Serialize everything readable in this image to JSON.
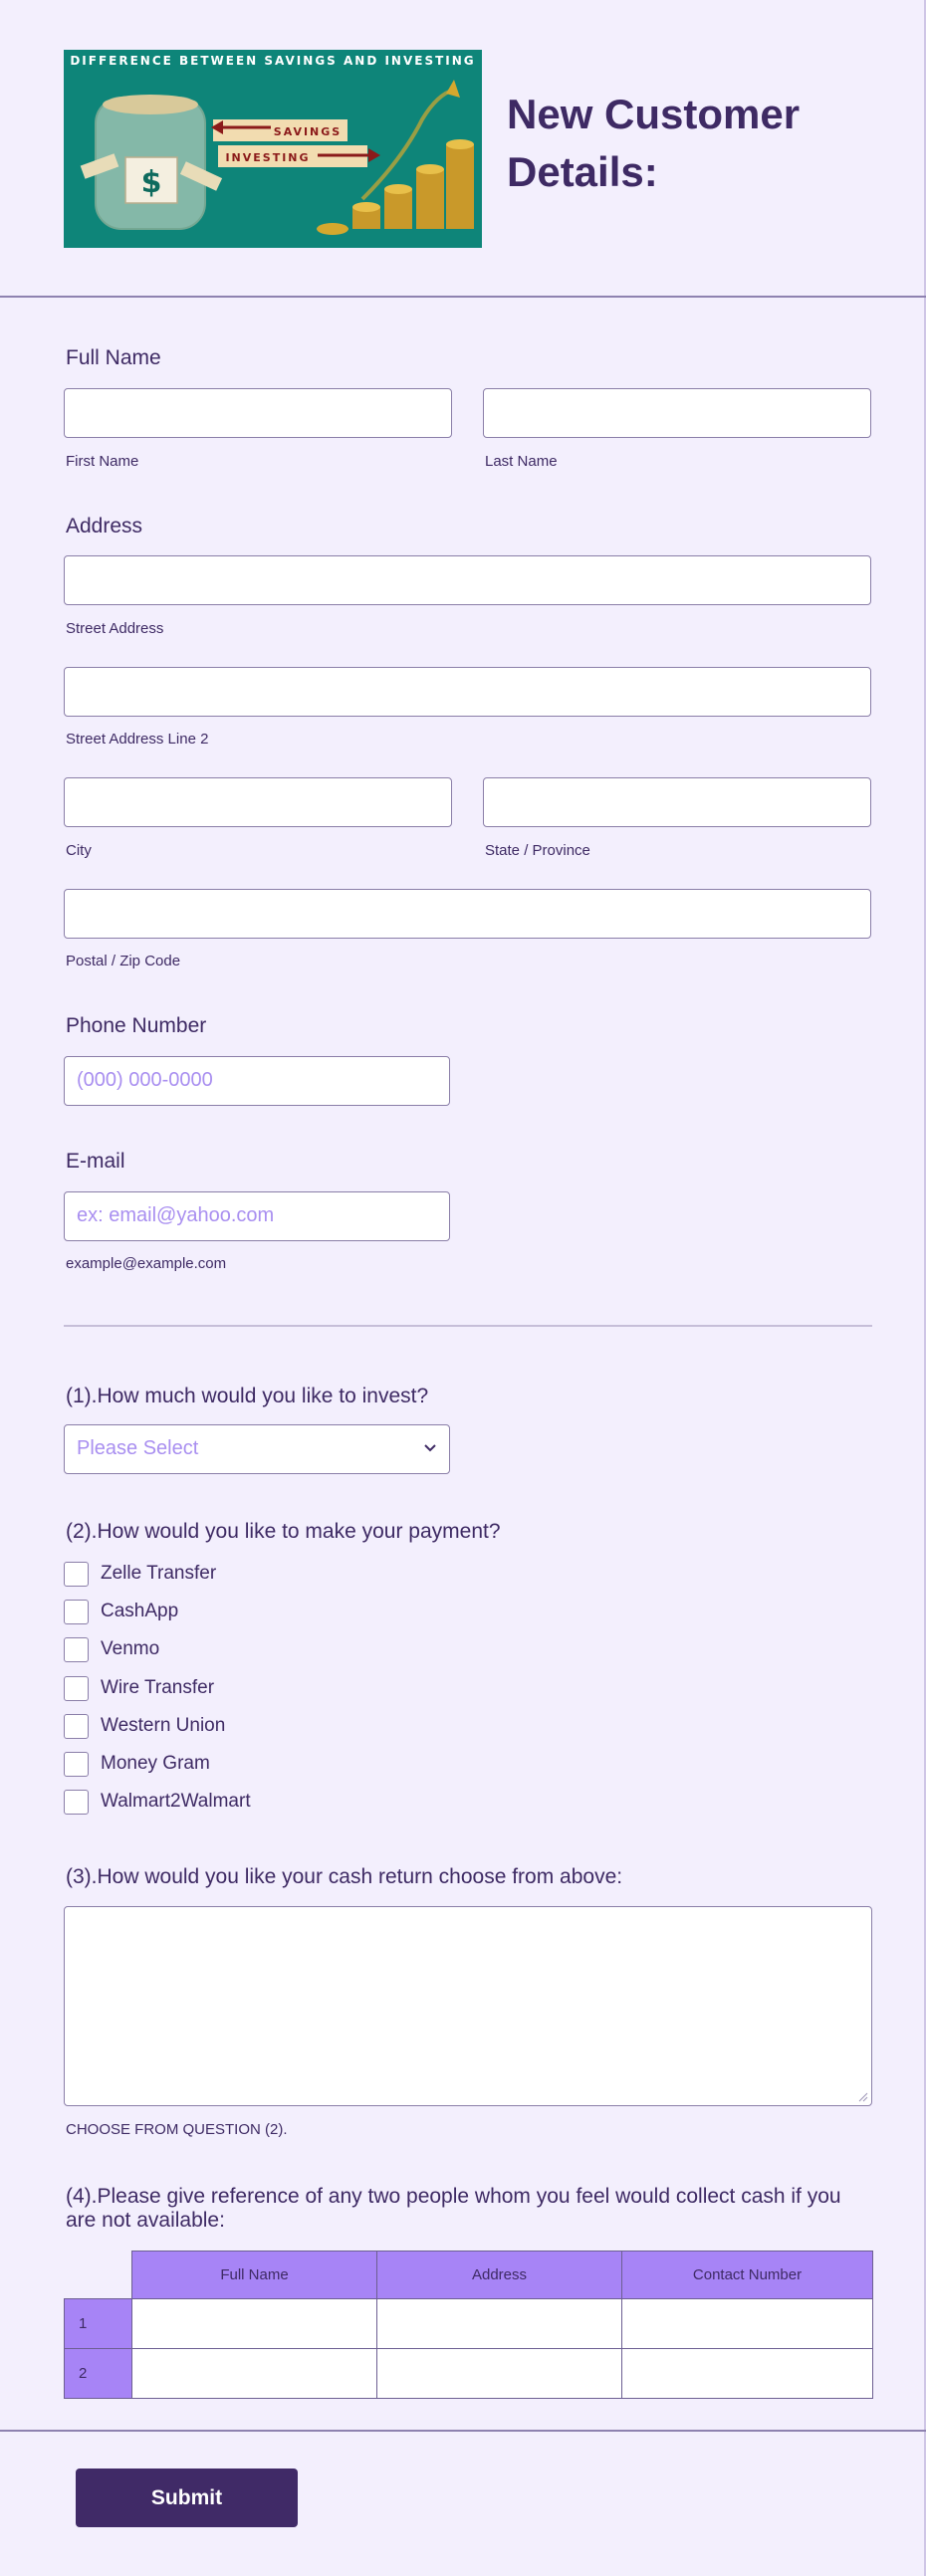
{
  "banner": {
    "title": "DIFFERENCE BETWEEN SAVINGS AND INVESTING",
    "savings_label": "SAVINGS",
    "investing_label": "INVESTING",
    "dollar_symbol": "$"
  },
  "page": {
    "heading_line1": "New Customer",
    "heading_line2": "Details:"
  },
  "full_name": {
    "label": "Full Name",
    "first_sub": "First Name",
    "last_sub": "Last Name"
  },
  "address": {
    "label": "Address",
    "street_sub": "Street Address",
    "street2_sub": "Street Address Line 2",
    "city_sub": "City",
    "state_sub": "State / Province",
    "postal_sub": "Postal / Zip Code"
  },
  "phone": {
    "label": "Phone Number",
    "placeholder": "(000) 000-0000"
  },
  "email": {
    "label": "E-mail",
    "placeholder": "ex: email@yahoo.com",
    "sub": "example@example.com"
  },
  "q1": {
    "label": "(1).How much would you like to invest?",
    "selected": "Please Select"
  },
  "q2": {
    "label": "(2).How would you like to make your payment?",
    "options": [
      "Zelle Transfer",
      "CashApp",
      "Venmo",
      "Wire Transfer",
      "Western Union",
      "Money Gram",
      "Walmart2Walmart"
    ]
  },
  "q3": {
    "label": "(3).How would you like your cash return choose from above:",
    "sub": "CHOOSE FROM QUESTION (2)."
  },
  "q4": {
    "label_line1": "(4).Please give reference of any two people whom you feel would collect cash if you",
    "label_line2": "are not available:",
    "columns": [
      "Full Name",
      "Address",
      "Contact Number"
    ],
    "rows": [
      "1",
      "2"
    ]
  },
  "submit": {
    "label": "Submit"
  },
  "colors": {
    "background": "#f3effd",
    "text": "#3e2a64",
    "accent": "#a784f6",
    "submit": "#402a67",
    "banner": "#0e8579"
  }
}
